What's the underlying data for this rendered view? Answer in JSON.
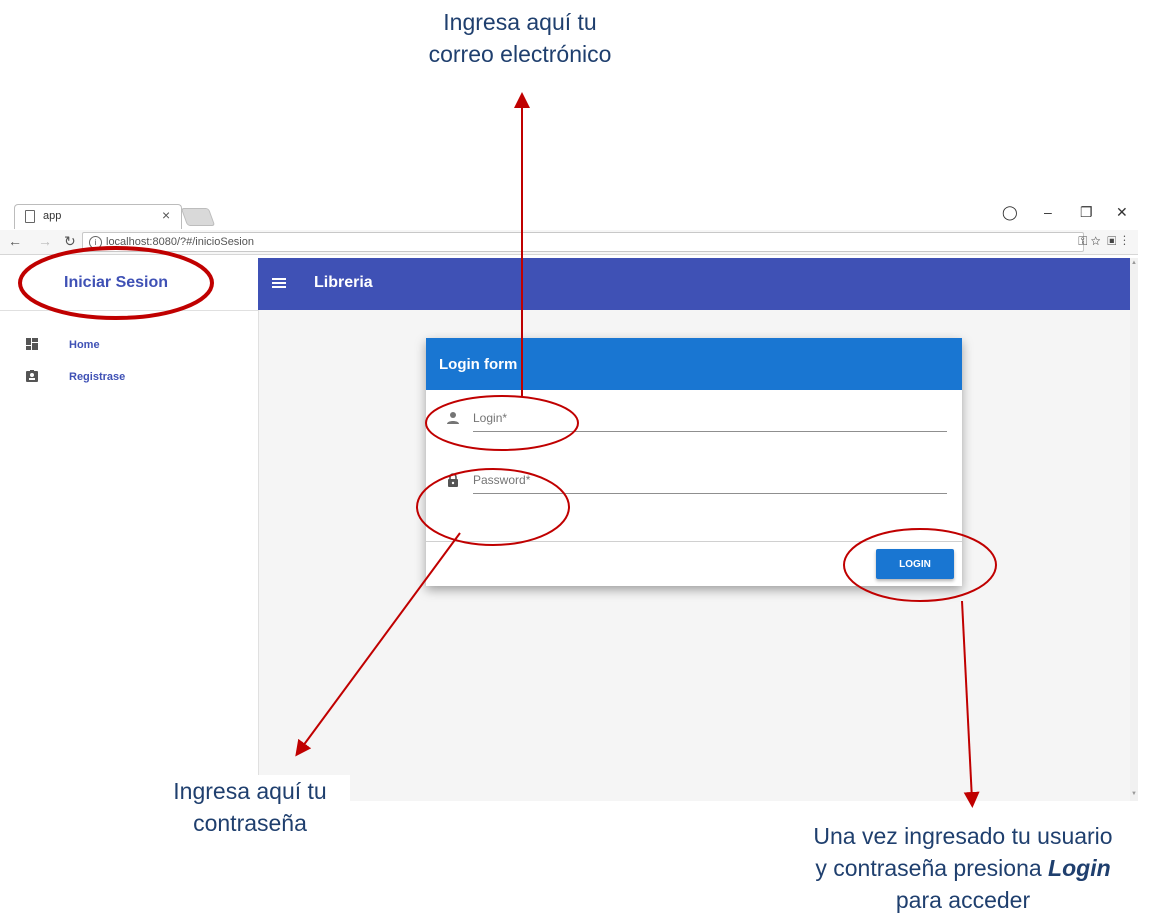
{
  "annotations": {
    "email": [
      "Ingresa aquí tu",
      "correo electrónico"
    ],
    "password": [
      "Ingresa aquí tu",
      "contraseña"
    ],
    "login_line1": "Una vez ingresado tu usuario",
    "login_line2_prefix": "y contraseña presiona ",
    "login_line2_bold": "Login",
    "login_line3": "para acceder"
  },
  "browser": {
    "tab_title": "app",
    "tab_close": "×",
    "url": "localhost:8080/?#/inicioSesion"
  },
  "sidebar": {
    "title": "Iniciar Sesion",
    "items": [
      {
        "label": "Home",
        "icon": "dashboard-icon"
      },
      {
        "label": "Registrase",
        "icon": "contact-badge-icon"
      }
    ]
  },
  "toolbar": {
    "title": "Libreria"
  },
  "login_form": {
    "title": "Login form",
    "login_placeholder": "Login*",
    "password_placeholder": "Password*",
    "button_label": "LOGIN"
  },
  "colors": {
    "primary": "#3f51b5",
    "card_header": "#1976d2",
    "annotation_red": "#c00000",
    "annotation_text": "#1f3f6e"
  }
}
